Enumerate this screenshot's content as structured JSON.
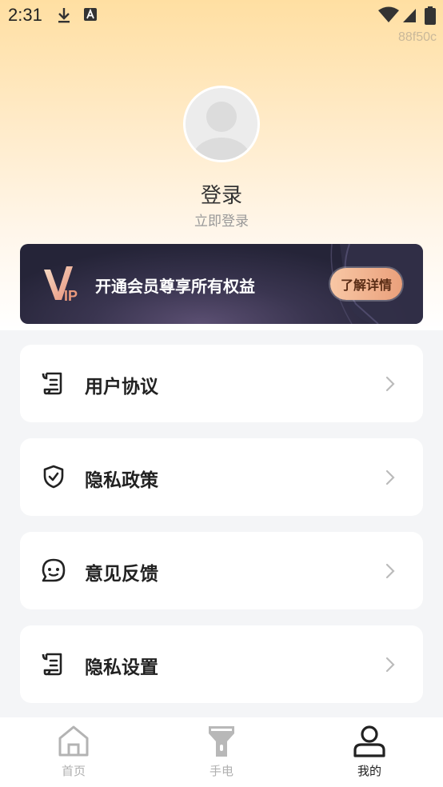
{
  "status_bar": {
    "time": "2:31",
    "build_id": "88f50c"
  },
  "profile": {
    "login_title": "登录",
    "login_subtitle": "立即登录"
  },
  "vip": {
    "badge_text": "VIP",
    "text": "开通会员尊享所有权益",
    "button_label": "了解详情"
  },
  "menu": {
    "items": [
      {
        "label": "用户协议",
        "icon": "scroll-document-icon"
      },
      {
        "label": "隐私政策",
        "icon": "shield-check-icon"
      },
      {
        "label": "意见反馈",
        "icon": "chat-bubble-icon"
      },
      {
        "label": "隐私设置",
        "icon": "scroll-document-icon"
      }
    ]
  },
  "tab_bar": {
    "tabs": [
      {
        "label": "首页",
        "icon": "home-icon",
        "active": false
      },
      {
        "label": "手电",
        "icon": "flashlight-icon",
        "active": false
      },
      {
        "label": "我的",
        "icon": "user-icon",
        "active": true
      }
    ]
  },
  "colors": {
    "header_gradient_top": "#ffdfa2",
    "vip_banner": "#2a283d",
    "vip_button": "#eaa07b",
    "tab_active": "#222222",
    "tab_inactive": "#b0b0b0"
  }
}
